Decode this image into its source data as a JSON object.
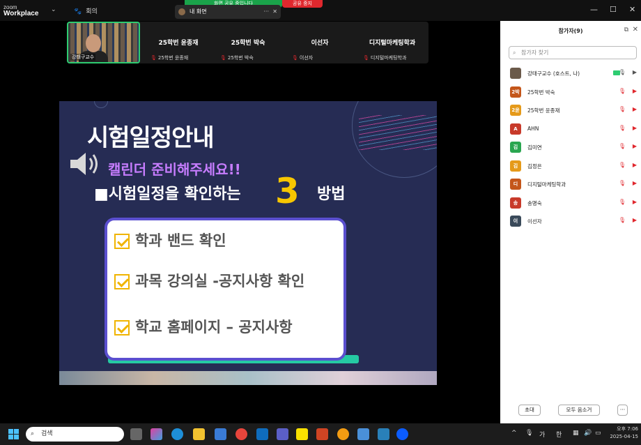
{
  "titlebar": {
    "logo_top": "zoom",
    "logo_bottom": "Workplace",
    "chevron": "⌄",
    "meeting_label": "회의",
    "share_banner": "화면 공유 중입니다",
    "stop_share": "공유 중지",
    "mini_label": "내 화면",
    "mini_more": "···",
    "mini_close": "✕",
    "win_min": "—",
    "win_max": "☐",
    "win_close": "✕"
  },
  "video_strip": {
    "self_label": "강태구교수",
    "tiles": [
      {
        "name": "25학번 윤종재",
        "sub": "25학번 윤종재"
      },
      {
        "name": "25학번 박숙",
        "sub": "25학번 박숙"
      },
      {
        "name": "이선자",
        "sub": "이선자"
      },
      {
        "name": "디지털마케팅학과",
        "sub": "디지털마케팅학과"
      }
    ]
  },
  "slide": {
    "title": "시험일정안내",
    "calendar_note": "캘린더 준비해주세요!!",
    "headline": "■시험일정을 확인하는",
    "number": "3",
    "method": "방법",
    "items": [
      "학과 밴드 확인",
      "과목 강의실 -공지사항 확인",
      "학교 홈페이지 – 공지사항"
    ]
  },
  "participants": {
    "title": "참가자(9)",
    "popout_icon": "⧉",
    "close_icon": "✕",
    "search_placeholder": "참가자 찾기",
    "list": [
      {
        "avatar": "",
        "name": "강태구교수 (호스트, 나)",
        "color": "#6b5a4a",
        "host": true
      },
      {
        "avatar": "2박",
        "name": "25학번 박숙",
        "color": "#c4561a"
      },
      {
        "avatar": "2윤",
        "name": "25학번 윤종재",
        "color": "#e59a1a"
      },
      {
        "avatar": "A",
        "name": "AHN",
        "color": "#c83a2a"
      },
      {
        "avatar": "김",
        "name": "김미연",
        "color": "#2aa650"
      },
      {
        "avatar": "김",
        "name": "김정은",
        "color": "#e59a1a"
      },
      {
        "avatar": "디",
        "name": "디지털마케팅학과",
        "color": "#c4561a"
      },
      {
        "avatar": "송",
        "name": "송명숙",
        "color": "#c83a2a"
      },
      {
        "avatar": "이",
        "name": "이선자",
        "color": "#3a4a5a"
      }
    ],
    "invite_button": "초대",
    "mute_all_button": "모두 음소거",
    "more_button": "···"
  },
  "taskbar": {
    "search_placeholder": "검색",
    "ime_ga": "가",
    "ime_han": "한",
    "chevron_up": "^",
    "time": "오후 7:06",
    "date": "2025-04-15"
  }
}
